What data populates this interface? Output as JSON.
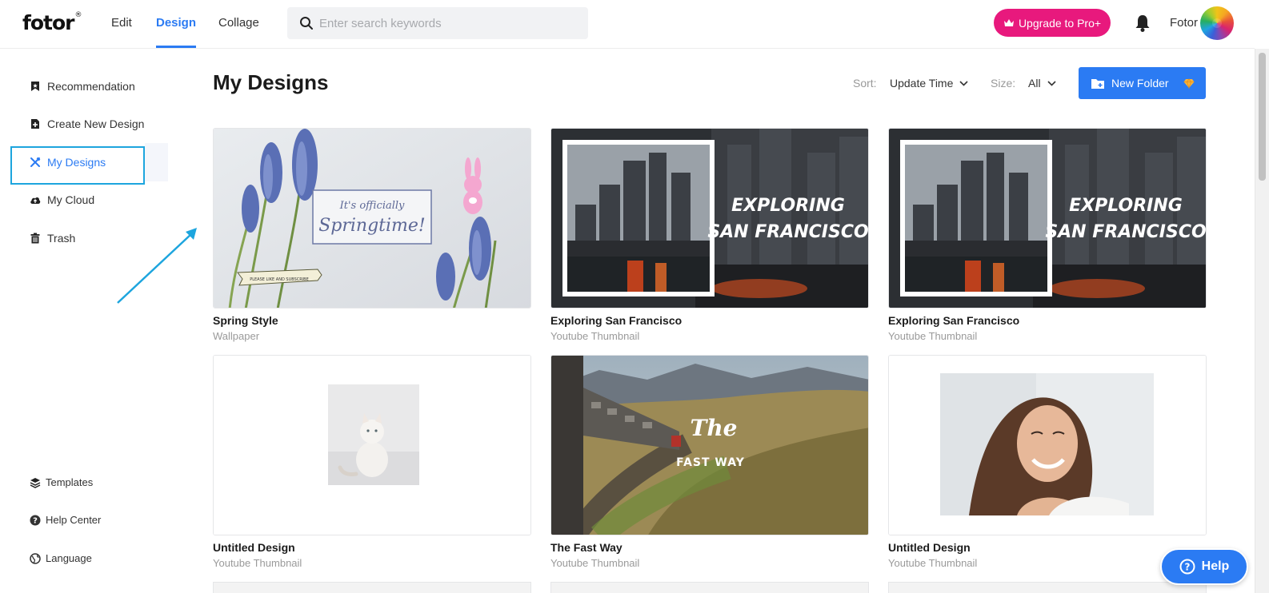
{
  "header": {
    "logo_text": "fotor",
    "logo_mark": "®",
    "tabs": [
      {
        "label": "Edit",
        "active": false
      },
      {
        "label": "Design",
        "active": true
      },
      {
        "label": "Collage",
        "active": false
      }
    ],
    "search_placeholder": "Enter search keywords",
    "upgrade_label": "Upgrade to Pro+",
    "username": "Fotor",
    "accent_color": "#2b7bf3",
    "upgrade_color": "#e8197d"
  },
  "sidebar": {
    "items": [
      {
        "label": "Recommendation",
        "icon": "bookmark-icon"
      },
      {
        "label": "Create New Design",
        "icon": "file-plus-icon"
      },
      {
        "label": "My Designs",
        "icon": "design-tools-icon",
        "active": true
      },
      {
        "label": "My Cloud",
        "icon": "cloud-upload-icon"
      },
      {
        "label": "Trash",
        "icon": "trash-icon"
      }
    ],
    "bottom_items": [
      {
        "label": "Templates",
        "icon": "layers-icon"
      },
      {
        "label": "Help Center",
        "icon": "help-circle-icon"
      },
      {
        "label": "Language",
        "icon": "globe-icon"
      }
    ]
  },
  "main": {
    "title": "My Designs",
    "sort_label": "Sort:",
    "sort_value": "Update Time",
    "size_label": "Size:",
    "size_value": "All",
    "new_folder_label": "New Folder",
    "designs": [
      {
        "title": "Spring Style",
        "type": "Wallpaper",
        "thumb_text_1": "It's officially",
        "thumb_text_2": "Springtime!",
        "thumb_text_3": "PLEASE LIKE AND SUBSCRIBE"
      },
      {
        "title": "Exploring San Francisco",
        "type": "Youtube Thumbnail",
        "thumb_text_1": "EXPLORING",
        "thumb_text_2": "SAN FRANCISCO"
      },
      {
        "title": "Exploring San Francisco",
        "type": "Youtube Thumbnail",
        "thumb_text_1": "EXPLORING",
        "thumb_text_2": "SAN FRANCISCO"
      },
      {
        "title": "Untitled Design",
        "type": "Youtube Thumbnail"
      },
      {
        "title": "The Fast Way",
        "type": "Youtube Thumbnail",
        "thumb_text_1": "The",
        "thumb_text_2": "FAST WAY"
      },
      {
        "title": "Untitled Design",
        "type": "Youtube Thumbnail"
      }
    ]
  },
  "help_button_label": "Help"
}
